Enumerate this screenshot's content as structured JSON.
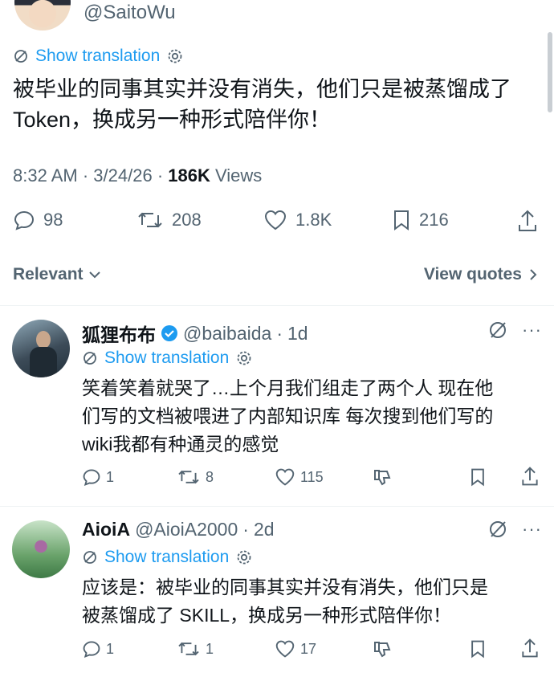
{
  "main_post": {
    "handle": "@SaitoWu",
    "show_translation": "Show translation",
    "text_line1": "被毕业的同事其实并没有消失，他们只是被蒸馏成了",
    "text_line2": "Token，换成另一种形式陪伴你！",
    "time": "8:32 AM",
    "date": "3/24/26",
    "views_count": "186K",
    "views_label": "Views",
    "replies": "98",
    "reposts": "208",
    "likes": "1.8K",
    "bookmarks": "216"
  },
  "sort": {
    "label": "Relevant",
    "view_quotes": "View quotes"
  },
  "replies": [
    {
      "name": "狐狸布布",
      "verified": true,
      "handle": "@baibaida",
      "age": "1d",
      "show_translation": "Show translation",
      "lines": [
        "笑着笑着就哭了…上个月我们组走了两个人 现在他",
        "们写的文档被喂进了内部知识库 每次搜到他们写的",
        "wiki我都有种通灵的感觉"
      ],
      "replies": "1",
      "reposts": "8",
      "likes": "115"
    },
    {
      "name": "AioiA",
      "verified": false,
      "handle": "@AioiA2000",
      "age": "2d",
      "show_translation": "Show translation",
      "lines": [
        "应该是：被毕业的同事其实并没有消失，他们只是",
        "被蒸馏成了 SKILL，换成另一种形式陪伴你！"
      ],
      "replies": "1",
      "reposts": "1",
      "likes": "17"
    }
  ],
  "colors": {
    "accent": "#1d9bf0",
    "muted": "#536471",
    "text": "#0f1419"
  }
}
